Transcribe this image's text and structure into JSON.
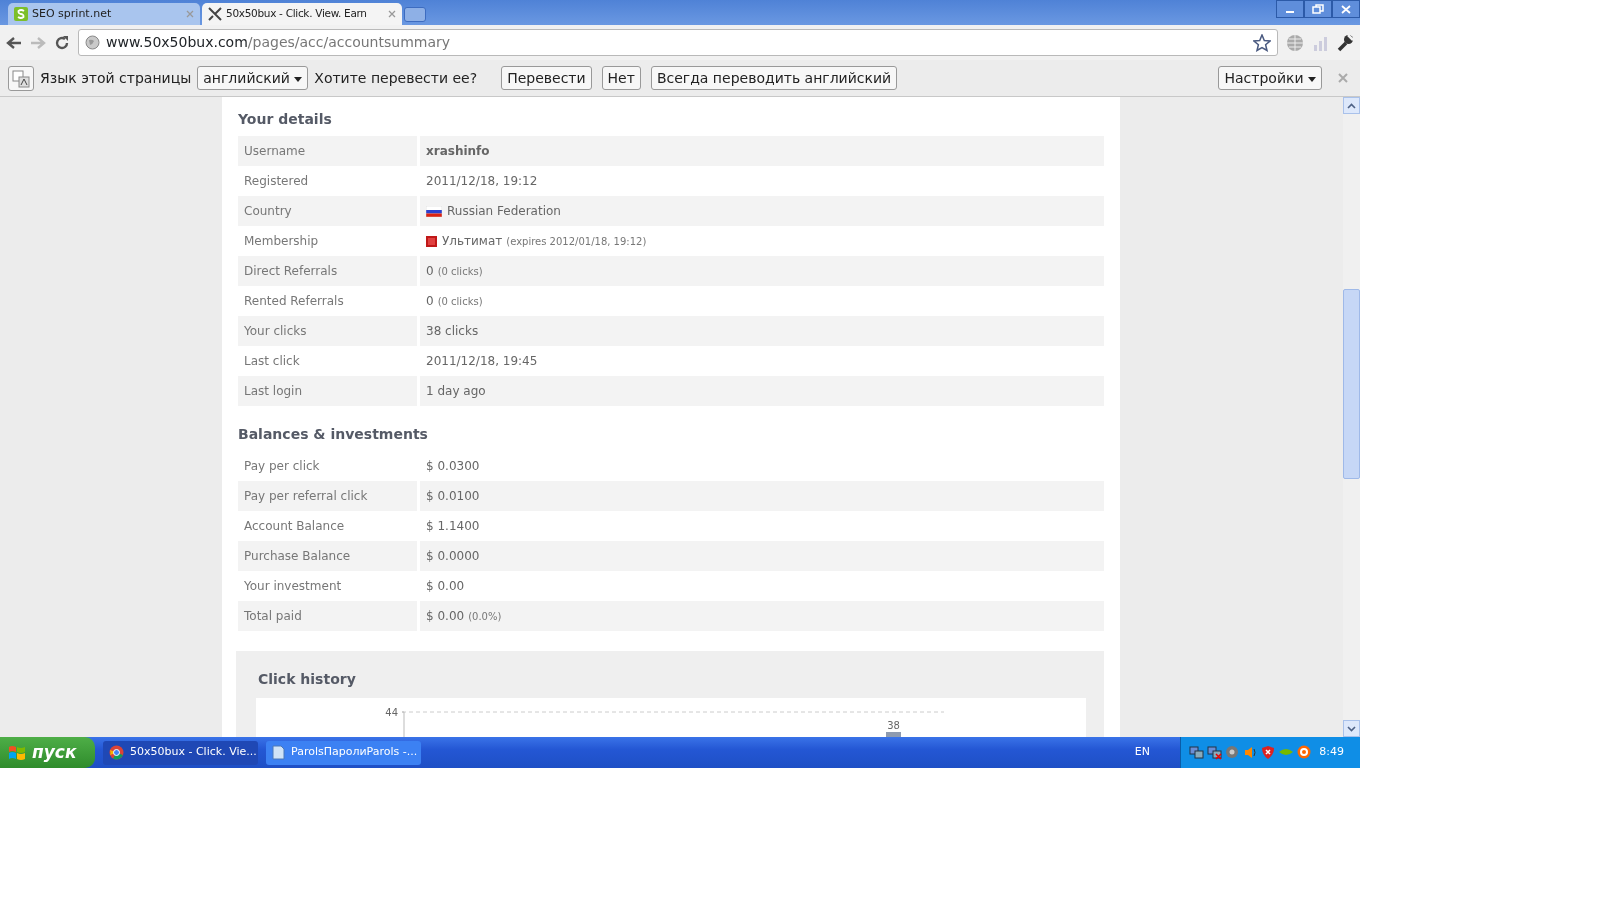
{
  "browser": {
    "tabs": [
      {
        "title": "SEO sprint.net",
        "selected": false
      },
      {
        "title": "50x50bux - Click. View. Earn",
        "selected": true
      }
    ],
    "address": {
      "host": "www.50x50bux.com",
      "path": "/pages/acc/accountsummary"
    },
    "translate_bar": {
      "label": "Язык этой страницы",
      "language": "английский",
      "question": "Хотите перевести ее?",
      "buttons": [
        "Перевести",
        "Нет",
        "Всегда переводить английский"
      ],
      "options": "Настройки"
    }
  },
  "details": {
    "title": "Your details",
    "rows": [
      {
        "label": "Username",
        "kind": "bold",
        "value": "xrashinfo"
      },
      {
        "label": "Registered",
        "kind": "text",
        "value": "2011/12/18, 19:12"
      },
      {
        "label": "Country",
        "kind": "flag",
        "value": "Russian Federation"
      },
      {
        "label": "Membership",
        "kind": "membership",
        "value": "Ультимат",
        "note": "(expires 2012/01/18, 19:12)"
      },
      {
        "label": "Direct Referrals",
        "kind": "text",
        "value": "0",
        "note": "(0 clicks)"
      },
      {
        "label": "Rented Referrals",
        "kind": "text",
        "value": "0",
        "note": "(0 clicks)"
      },
      {
        "label": "Your clicks",
        "kind": "text",
        "value": "38 clicks"
      },
      {
        "label": "Last click",
        "kind": "text",
        "value": "2011/12/18, 19:45"
      },
      {
        "label": "Last login",
        "kind": "text",
        "value": "1 day ago"
      }
    ]
  },
  "balances": {
    "title": "Balances & investments",
    "rows": [
      {
        "label": "Pay per click",
        "kind": "text",
        "value": "$ 0.0300"
      },
      {
        "label": "Pay per referral click",
        "kind": "text",
        "value": "$ 0.0100"
      },
      {
        "label": "Account Balance",
        "kind": "text",
        "value": "$ 1.1400"
      },
      {
        "label": "Purchase Balance",
        "kind": "text",
        "value": "$ 0.0000"
      },
      {
        "label": "Your investment",
        "kind": "text",
        "value": "$ 0.00"
      },
      {
        "label": "Total paid",
        "kind": "text",
        "value": "$ 0.00",
        "note": "(0.0%)"
      }
    ]
  },
  "click_history": {
    "title": "Click history",
    "axis_label": "44",
    "bar_label": "38"
  },
  "taskbar": {
    "start": "пуск",
    "tasks": [
      {
        "title": "50x50bux - Click. Vie...",
        "selected": true
      },
      {
        "title": "ParolsПаролиParols -...",
        "selected": false
      }
    ],
    "language": "EN",
    "clock": "8:49"
  }
}
